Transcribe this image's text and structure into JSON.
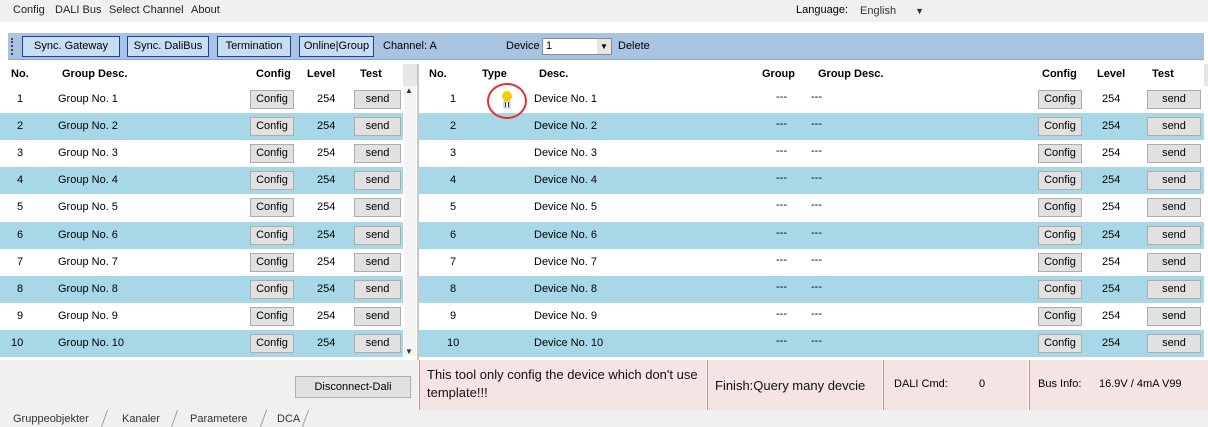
{
  "menu": [
    "Config",
    "DALI Bus",
    "Select Channel",
    "About"
  ],
  "language": {
    "label": "Language:",
    "value": "English"
  },
  "toolbar": {
    "sync_gateway": "Sync. Gateway",
    "sync_dalibus": "Sync. DaliBus",
    "termination": "Termination",
    "online_group": "Online|Group",
    "channel": "Channel:  A",
    "device_label": "Device",
    "device_value": "1",
    "delete": "Delete"
  },
  "group_table": {
    "headers": [
      "No.",
      "Group Desc.",
      "Config",
      "Level",
      "Test"
    ],
    "rows": [
      {
        "no": "1",
        "desc": "Group No. 1",
        "config": "Config",
        "level": "254",
        "test": "send"
      },
      {
        "no": "2",
        "desc": "Group No. 2",
        "config": "Config",
        "level": "254",
        "test": "send"
      },
      {
        "no": "3",
        "desc": "Group No. 3",
        "config": "Config",
        "level": "254",
        "test": "send"
      },
      {
        "no": "4",
        "desc": "Group No. 4",
        "config": "Config",
        "level": "254",
        "test": "send"
      },
      {
        "no": "5",
        "desc": "Group No. 5",
        "config": "Config",
        "level": "254",
        "test": "send"
      },
      {
        "no": "6",
        "desc": "Group No. 6",
        "config": "Config",
        "level": "254",
        "test": "send"
      },
      {
        "no": "7",
        "desc": "Group No. 7",
        "config": "Config",
        "level": "254",
        "test": "send"
      },
      {
        "no": "8",
        "desc": "Group No. 8",
        "config": "Config",
        "level": "254",
        "test": "send"
      },
      {
        "no": "9",
        "desc": "Group No. 9",
        "config": "Config",
        "level": "254",
        "test": "send"
      },
      {
        "no": "10",
        "desc": "Group No. 10",
        "config": "Config",
        "level": "254",
        "test": "send"
      }
    ]
  },
  "device_table": {
    "headers": [
      "No.",
      "Type",
      "Desc.",
      "Group",
      "Group Desc.",
      "Config",
      "Level",
      "Test"
    ],
    "rows": [
      {
        "no": "1",
        "desc": "Device No. 1",
        "group": "---",
        "gdesc": "---",
        "config": "Config",
        "level": "254",
        "test": "send"
      },
      {
        "no": "2",
        "desc": "Device No. 2",
        "group": "---",
        "gdesc": "---",
        "config": "Config",
        "level": "254",
        "test": "send"
      },
      {
        "no": "3",
        "desc": "Device No. 3",
        "group": "---",
        "gdesc": "---",
        "config": "Config",
        "level": "254",
        "test": "send"
      },
      {
        "no": "4",
        "desc": "Device No. 4",
        "group": "---",
        "gdesc": "---",
        "config": "Config",
        "level": "254",
        "test": "send"
      },
      {
        "no": "5",
        "desc": "Device No. 5",
        "group": "---",
        "gdesc": "---",
        "config": "Config",
        "level": "254",
        "test": "send"
      },
      {
        "no": "6",
        "desc": "Device No. 6",
        "group": "---",
        "gdesc": "---",
        "config": "Config",
        "level": "254",
        "test": "send"
      },
      {
        "no": "7",
        "desc": "Device No. 7",
        "group": "---",
        "gdesc": "---",
        "config": "Config",
        "level": "254",
        "test": "send"
      },
      {
        "no": "8",
        "desc": "Device No. 8",
        "group": "---",
        "gdesc": "---",
        "config": "Config",
        "level": "254",
        "test": "send"
      },
      {
        "no": "9",
        "desc": "Device No. 9",
        "group": "---",
        "gdesc": "---",
        "config": "Config",
        "level": "254",
        "test": "send"
      },
      {
        "no": "10",
        "desc": "Device No. 10",
        "group": "---",
        "gdesc": "---",
        "config": "Config",
        "level": "254",
        "test": "send"
      }
    ],
    "first_row_type_icon": "light-bulb-icon"
  },
  "status": {
    "disconnect": "Disconnect-Dali",
    "message": "This tool only config the device which don't use template!!!",
    "finish": "Finish:Query many devcie",
    "dali_cmd_label": "DALI Cmd:",
    "dali_cmd_value": "0",
    "bus_info_label": "Bus Info:",
    "bus_info_value": "16.9V / 4mA V99"
  },
  "tabs": [
    "Gruppeobjekter",
    "Kanaler",
    "Parametere",
    "DCA"
  ],
  "colors": {
    "row_alt": "#a8d8e8",
    "toolbar": "#a8c4e0",
    "button_border": "#1a3ea8",
    "status_pink": "#f4e4e4"
  }
}
